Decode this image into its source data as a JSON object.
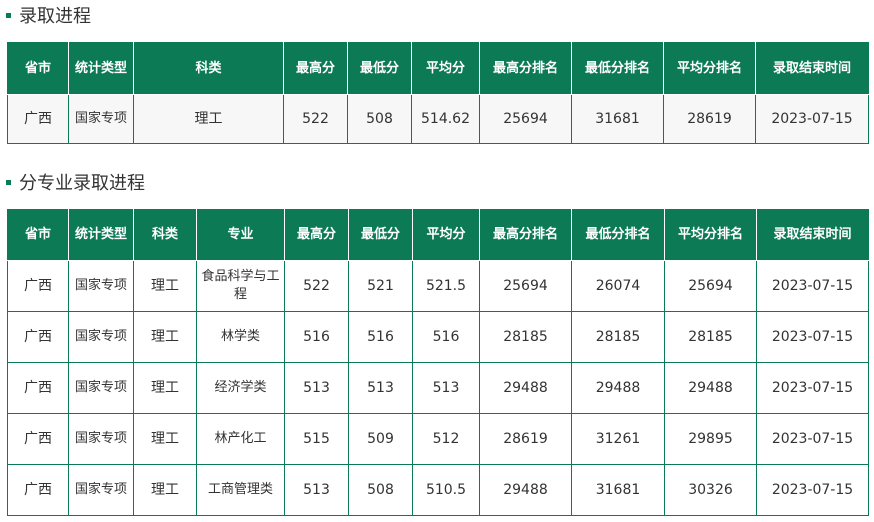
{
  "section1": {
    "title": "录取进程",
    "headers": [
      "省市",
      "统计类型",
      "科类",
      "最高分",
      "最低分",
      "平均分",
      "最高分排名",
      "最低分排名",
      "平均分排名",
      "录取结束时间"
    ],
    "rows": [
      [
        "广西",
        "国家专项",
        "理工",
        "522",
        "508",
        "514.62",
        "25694",
        "31681",
        "28619",
        "2023-07-15"
      ]
    ]
  },
  "section2": {
    "title": "分专业录取进程",
    "headers": [
      "省市",
      "统计类型",
      "科类",
      "专业",
      "最高分",
      "最低分",
      "平均分",
      "最高分排名",
      "最低分排名",
      "平均分排名",
      "录取结束时间"
    ],
    "rows": [
      [
        "广西",
        "国家专项",
        "理工",
        "食品科学与工程",
        "522",
        "521",
        "521.5",
        "25694",
        "26074",
        "25694",
        "2023-07-15"
      ],
      [
        "广西",
        "国家专项",
        "理工",
        "林学类",
        "516",
        "516",
        "516",
        "28185",
        "28185",
        "28185",
        "2023-07-15"
      ],
      [
        "广西",
        "国家专项",
        "理工",
        "经济学类",
        "513",
        "513",
        "513",
        "29488",
        "29488",
        "29488",
        "2023-07-15"
      ],
      [
        "广西",
        "国家专项",
        "理工",
        "林产化工",
        "515",
        "509",
        "512",
        "28619",
        "31261",
        "29895",
        "2023-07-15"
      ],
      [
        "广西",
        "国家专项",
        "理工",
        "工商管理类",
        "513",
        "508",
        "510.5",
        "29488",
        "31681",
        "30326",
        "2023-07-15"
      ]
    ]
  },
  "colors": {
    "accent": "#0b7a55",
    "header_text": "#ffffff",
    "body_text": "#333333"
  }
}
